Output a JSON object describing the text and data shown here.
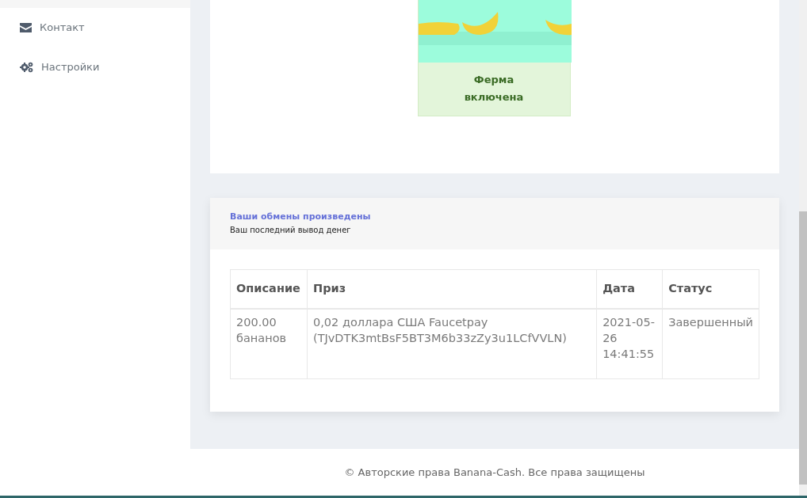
{
  "sidebar": {
    "items": [
      {
        "label": "Контакт"
      },
      {
        "label": "Настройки"
      }
    ]
  },
  "farm": {
    "status": "Ферма включена"
  },
  "exchanges": {
    "title": "Ваши обмены произведены",
    "subtitle": "Ваш последний вывод денег",
    "table": {
      "columns": [
        "Описание",
        "Приз",
        "Дата",
        "Статус"
      ],
      "rows": [
        [
          "200.00 бананов",
          "0,02 доллара США Faucetpay (TJvDTK3mtBsF5BT3M6b33zZy3u1LCfVVLN)",
          "2021-05-26 14:41:55",
          "Завершенный"
        ]
      ]
    }
  },
  "footer": {
    "text": "© Авторские права Banana-Cash. Все права защищены"
  }
}
